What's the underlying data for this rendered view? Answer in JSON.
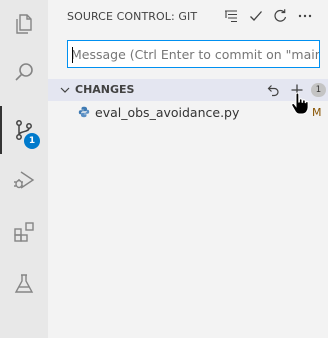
{
  "activity_bar": {
    "items": [
      {
        "name": "explorer",
        "icon": "files-icon"
      },
      {
        "name": "search",
        "icon": "search-icon"
      },
      {
        "name": "source-control",
        "icon": "source-control-icon",
        "badge": "1",
        "active": true
      },
      {
        "name": "run-and-debug",
        "icon": "run-debug-icon"
      },
      {
        "name": "extensions",
        "icon": "extensions-icon"
      },
      {
        "name": "testing",
        "icon": "beaker-icon"
      }
    ]
  },
  "sidebar": {
    "title": "SOURCE CONTROL: GIT",
    "header_actions": [
      "view-as-tree-icon",
      "commit-check-icon",
      "refresh-icon",
      "more-actions-icon"
    ],
    "commit_message": {
      "value": "",
      "placeholder": "Message (Ctrl Enter to commit on \"main\")"
    },
    "changes": {
      "label": "CHANGES",
      "count": "1",
      "actions": [
        "discard-all-icon",
        "stage-all-icon"
      ],
      "files": [
        {
          "name": "eval_obs_avoidance.py",
          "status": "M",
          "icon": "python-file-icon"
        }
      ]
    }
  },
  "colors": {
    "accent": "#007acc",
    "focus_border": "#0090f1",
    "modified": "#895503",
    "sidebar_bg": "#f3f3f3",
    "activity_bg": "#e8e8e8"
  }
}
